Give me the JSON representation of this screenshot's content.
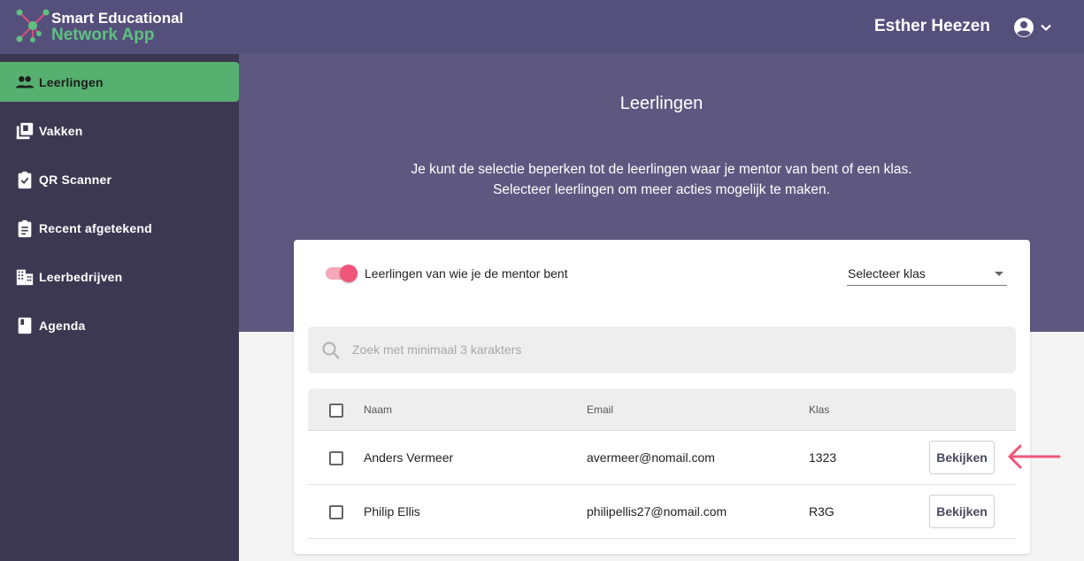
{
  "app": {
    "brand_line1": "Smart Educational",
    "brand_line2": "Network App",
    "user_name": "Esther Heezen",
    "colors": {
      "header": "#554f7c",
      "hero": "#5e5880",
      "sidebar": "#3d3851",
      "active": "#56b06f",
      "accent_pink": "#f0567a",
      "brand_green": "#5fc080"
    }
  },
  "header": {
    "account_icon": "account-circle-icon",
    "dropdown_icon": "chevron-down-icon"
  },
  "sidebar": {
    "items": [
      {
        "label": "Leerlingen",
        "icon": "people-icon",
        "active": true
      },
      {
        "label": "Vakken",
        "icon": "library-books-icon",
        "active": false
      },
      {
        "label": "QR Scanner",
        "icon": "clipboard-check-icon",
        "active": false
      },
      {
        "label": "Recent afgetekend",
        "icon": "clipboard-list-icon",
        "active": false
      },
      {
        "label": "Leerbedrijven",
        "icon": "building-icon",
        "active": false
      },
      {
        "label": "Agenda",
        "icon": "book-icon",
        "active": false
      }
    ]
  },
  "main": {
    "title": "Leerlingen",
    "intro_line1": "Je kunt de selectie beperken tot de leerlingen waar je mentor van bent of een klas.",
    "intro_line2": "Selecteer leerlingen om meer acties mogelijk te maken."
  },
  "filters": {
    "mentor_toggle_label": "Leerlingen van wie je de mentor bent",
    "mentor_toggle_on": true,
    "class_select_value": "Selecteer klas"
  },
  "search": {
    "placeholder": "Zoek met minimaal 3 karakters",
    "value": ""
  },
  "table": {
    "columns": [
      "Naam",
      "Email",
      "Klas"
    ],
    "rows": [
      {
        "name": "Anders Vermeer",
        "email": "avermeer@nomail.com",
        "klas": "1323",
        "action": "Bekijken"
      },
      {
        "name": "Philip Ellis",
        "email": "philipellis27@nomail.com",
        "klas": "R3G",
        "action": "Bekijken"
      }
    ]
  },
  "annotation": {
    "icon": "arrow-left-icon",
    "color": "#f0567a"
  }
}
